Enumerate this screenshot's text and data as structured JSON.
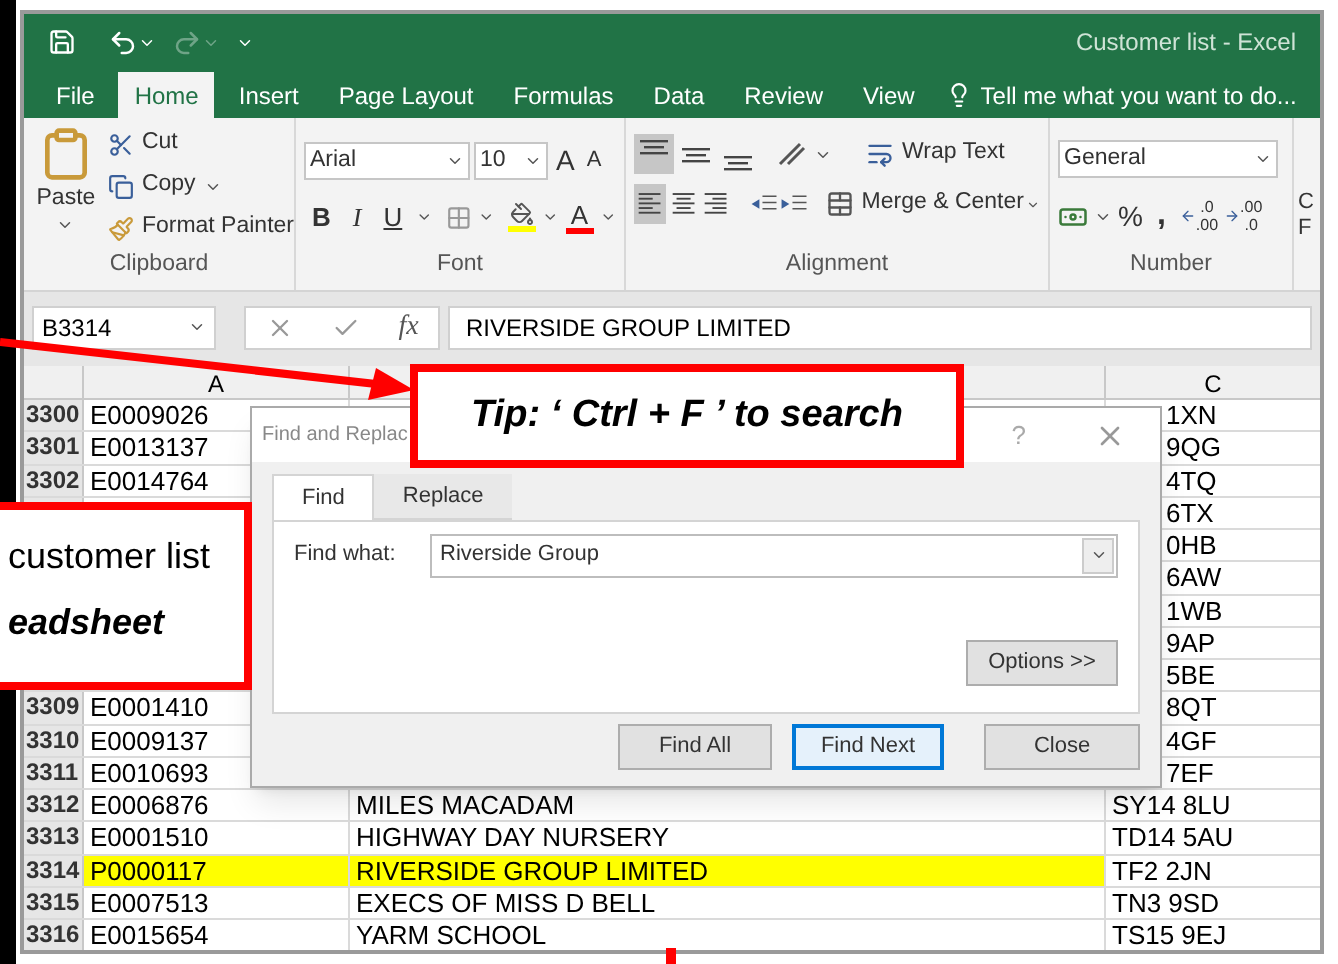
{
  "window": {
    "title": "Customer list - Excel"
  },
  "menu_tabs": [
    {
      "label": "File",
      "selected": false
    },
    {
      "label": "Home",
      "selected": true
    },
    {
      "label": "Insert",
      "selected": false
    },
    {
      "label": "Page Layout",
      "selected": false
    },
    {
      "label": "Formulas",
      "selected": false
    },
    {
      "label": "Data",
      "selected": false
    },
    {
      "label": "Review",
      "selected": false
    },
    {
      "label": "View",
      "selected": false
    }
  ],
  "tell_me": {
    "placeholder": "Tell me what you want to do..."
  },
  "ribbon": {
    "clipboard": {
      "label": "Clipboard",
      "paste": "Paste",
      "cut": "Cut",
      "copy": "Copy",
      "format_painter": "Format Painter"
    },
    "font": {
      "label": "Font",
      "font_name": "Arial",
      "font_size": "10",
      "grow": "A",
      "shrink": "A",
      "bold": "B",
      "italic": "I",
      "underline": "U",
      "font_color": "A"
    },
    "alignment": {
      "label": "Alignment",
      "wrap_text": "Wrap Text",
      "merge_center": "Merge & Center"
    },
    "number": {
      "label": "Number",
      "format": "General",
      "percent": "%",
      "comma": ",",
      "increase_decimal": [
        ".0",
        ".00"
      ],
      "decrease_decimal": [
        ".00",
        ".0"
      ]
    },
    "partial_group": [
      "C",
      "F"
    ]
  },
  "formula_bar": {
    "name_box": "B3314",
    "fx": "fx",
    "value": "RIVERSIDE GROUP LIMITED"
  },
  "column_headers": {
    "a": "A",
    "c": "C"
  },
  "rows": [
    {
      "num": "3300",
      "a": "E0009026",
      "c": "1XN",
      "selected": false
    },
    {
      "num": "3301",
      "a": "E0013137",
      "c": "9QG",
      "selected": false
    },
    {
      "num": "3302",
      "a": "E0014764",
      "c": "4TQ",
      "selected": false
    },
    {
      "c": "6TX"
    },
    {
      "c": "0HB"
    },
    {
      "c": "6AW"
    },
    {
      "c": "1WB"
    },
    {
      "c": "9AP"
    },
    {
      "c": "5BE"
    },
    {
      "num": "3309",
      "a": "E0001410",
      "c": "8QT",
      "selected": false
    },
    {
      "num": "3310",
      "a": "E0009137",
      "c": "4GF",
      "selected": false
    },
    {
      "num": "3311",
      "a": "E0010693",
      "c": "7EF",
      "selected": false
    },
    {
      "num": "3312",
      "a": "E0006876",
      "b": "MILES MACADAM",
      "c": "SY14 8LU",
      "selected": false
    },
    {
      "num": "3313",
      "a": "E0001510",
      "b": "HIGHWAY DAY NURSERY",
      "c": "TD14 5AU",
      "selected": false
    },
    {
      "num": "3314",
      "a": "P0000117",
      "b": "RIVERSIDE GROUP LIMITED",
      "c": "TF2 2JN",
      "selected": true
    },
    {
      "num": "3315",
      "a": "E0007513",
      "b": "EXECS OF MISS D BELL",
      "c": "TN3 9SD",
      "selected": false
    },
    {
      "num": "3316",
      "a": "E0015654",
      "b": "YARM SCHOOL",
      "c": "TS15 9EJ",
      "selected": false
    }
  ],
  "dialog": {
    "title": "Find and Replac",
    "help": "?",
    "tabs": [
      {
        "label": "Find",
        "selected": true
      },
      {
        "label": "Replace",
        "selected": false
      }
    ],
    "find_what_label": "Find what:",
    "find_what_value": "Riverside Group",
    "options_button": "Options >>",
    "find_all_button": "Find All",
    "find_next_button": "Find Next",
    "close_button": "Close"
  },
  "tip": {
    "text": "Tip: ‘ Ctrl + F ’ to search"
  },
  "callout": {
    "line_1": "customer list",
    "line_2": "eadsheet"
  }
}
